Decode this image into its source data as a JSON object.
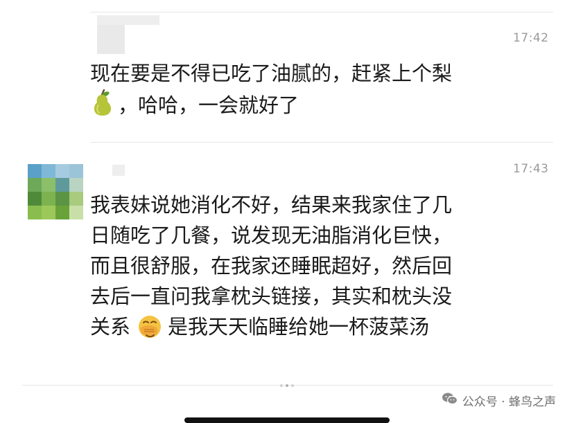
{
  "messages": [
    {
      "time": "17:42",
      "line1": "现在要是不得已吃了油腻的，赶紧上个梨",
      "line2_emoji": "pear-emoji",
      "line2_text": "，哈哈，一会就好了"
    },
    {
      "time": "17:43",
      "lines": [
        "我表妹说她消化不好，结果来我家住了几",
        "日随吃了几餐，说发现无油脂消化巨快，",
        "而且很舒服，在我家还睡眠超好，然后回",
        "去后一直问我拿枕头链接，其实和枕头没"
      ],
      "last_line_prefix": "关系",
      "last_line_emoji": "facepalm-emoji",
      "last_line_suffix": "是我天天临睡给她一杯菠菜汤"
    }
  ],
  "watermark": {
    "text": "公众号 · 蜂鸟之声",
    "icon": "wechat-icon"
  },
  "colors": {
    "text": "#1a1a1a",
    "time": "#9a9a9a",
    "divider": "#e6e6e6",
    "background": "#ffffff"
  }
}
